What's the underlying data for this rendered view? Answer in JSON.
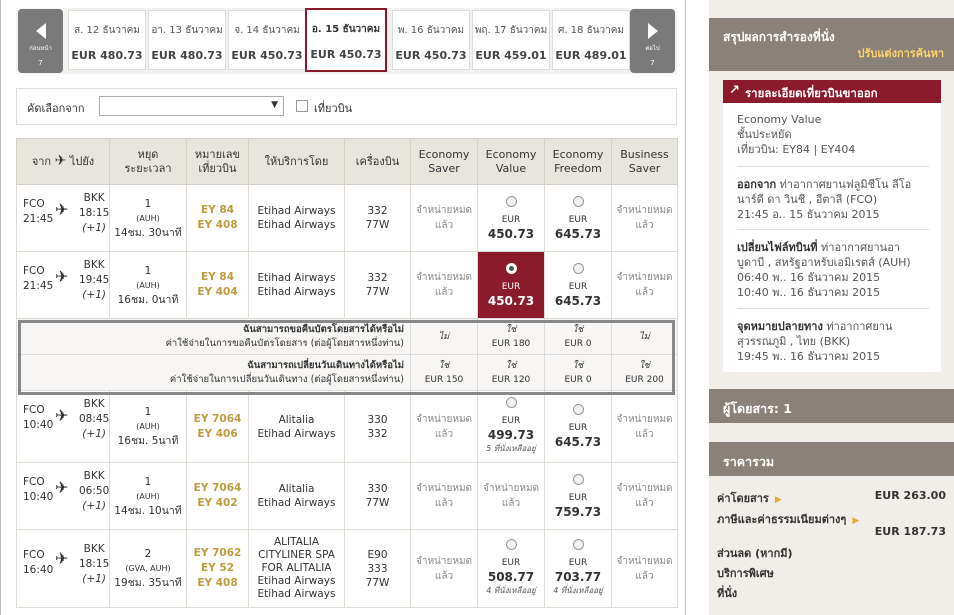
{
  "nav": {
    "prev_label": "ก่อนหน้า",
    "prev_num": "7",
    "next_label": "ต่อไป",
    "next_num": "7"
  },
  "dates": [
    {
      "label": "ส. 12 ธันวาคม",
      "price": "EUR 480.73"
    },
    {
      "label": "อา. 13 ธันวาคม",
      "price": "EUR 480.73"
    },
    {
      "label": "จ. 14 ธันวาคม",
      "price": "EUR 450.73"
    },
    {
      "label": "อ. 15 ธันวาคม",
      "price": "EUR 450.73"
    },
    {
      "label": "พ. 16 ธันวาคม",
      "price": "EUR 450.73"
    },
    {
      "label": "พฤ. 17 ธันวาคม",
      "price": "EUR 459.01"
    },
    {
      "label": "ศ. 18 ธันวาคม",
      "price": "EUR 489.01"
    }
  ],
  "filter": {
    "label": "คัดเลือกจาก",
    "checkbox_label": "เที่ยวบิน"
  },
  "headers": {
    "from": "จาก",
    "to": "ไปยัง",
    "stops": "หยุด",
    "duration": "ระยะเวลา",
    "flight1": "หมายเลข",
    "flight2": "เที่ยวบิน",
    "operator": "ให้บริการโดย",
    "aircraft": "เครื่องบิน",
    "c1a": "Economy",
    "c1b": "Saver",
    "c2a": "Economy",
    "c2b": "Value",
    "c3a": "Economy",
    "c3b": "Freedom",
    "c4a": "Business",
    "c4b": "Saver"
  },
  "na_text1": "จำหน่ายหมด",
  "na_text2": "แล้ว",
  "eur": "EUR",
  "rows": [
    {
      "dep": "FCO",
      "dep_t": "21:45",
      "arr": "BKK",
      "arr_t": "18:15",
      "plus": "(+1)",
      "stops": "1",
      "via": "(AUH)",
      "dur": "14ชม. 30นาที",
      "f1": "EY 84",
      "f2": "EY 408",
      "op1": "Etihad Airways",
      "op2": "Etihad Airways",
      "ac1": "332",
      "ac2": "77W",
      "value": "450.73",
      "freedom": "645.73"
    },
    {
      "dep": "FCO",
      "dep_t": "21:45",
      "arr": "BKK",
      "arr_t": "19:45",
      "plus": "(+1)",
      "stops": "1",
      "via": "(AUH)",
      "dur": "16ชม. 0นาที",
      "f1": "EY 84",
      "f2": "EY 404",
      "op1": "Etihad Airways",
      "op2": "Etihad Airways",
      "ac1": "332",
      "ac2": "77W",
      "value": "450.73",
      "freedom": "645.73"
    },
    {
      "dep": "FCO",
      "dep_t": "10:40",
      "arr": "BKK",
      "arr_t": "08:45",
      "plus": "(+1)",
      "stops": "1",
      "via": "(AUH)",
      "dur": "16ชม. 5นาที",
      "f1": "EY 7064",
      "f2": "EY 406",
      "op1": "Alitalia",
      "op2": "Etihad Airways",
      "ac1": "330",
      "ac2": "332",
      "value": "499.73",
      "value_seats": "5 ที่นั่งเหลืออยู่",
      "freedom": "645.73"
    },
    {
      "dep": "FCO",
      "dep_t": "10:40",
      "arr": "BKK",
      "arr_t": "06:50",
      "plus": "(+1)",
      "stops": "1",
      "via": "(AUH)",
      "dur": "14ชม. 10นาที",
      "f1": "EY 7064",
      "f2": "EY 402",
      "op1": "Alitalia",
      "op2": "Etihad Airways",
      "ac1": "330",
      "ac2": "77W",
      "freedom": "759.73"
    },
    {
      "dep": "FCO",
      "dep_t": "16:40",
      "arr": "BKK",
      "arr_t": "18:15",
      "plus": "(+1)",
      "stops": "2",
      "via": "(GVA, AUH)",
      "dur": "19ชม. 35นาที",
      "f1": "EY 7062",
      "f2": "EY 52",
      "f3": "EY 408",
      "op1": "ALITALIA",
      "op2": "CITYLINER SPA",
      "op3": "FOR ALITALIA",
      "op4": "Etihad Airways",
      "op5": "Etihad Airways",
      "ac1": "E90",
      "ac2": "333",
      "ac3": "77W",
      "value": "508.77",
      "value_seats": "4 ที่นั่งเหลืออยู่",
      "freedom": "703.77",
      "freedom_seats": "4 ที่นั่งเหลืออยู่"
    }
  ],
  "conditions": [
    {
      "t1": "ฉันสามารถขอคืนบัตรโดยสารได้หรือไม่",
      "t2": "ค่าใช้จ่ายในการขอคืนบัตรโดยสาร (ต่อผู้โดยสารหนึ่งท่าน)",
      "c1a": "ไม่",
      "c1b": "",
      "c2a": "ใช่",
      "c2b": "EUR 180",
      "c3a": "ใช่",
      "c3b": "EUR 0",
      "c4a": "ไม่",
      "c4b": ""
    },
    {
      "t1": "ฉันสามารถเปลี่ยนวันเดินทางได้หรือไม่",
      "t2": "ค่าใช้จ่ายในการเปลี่ยนวันเดินทาง (ต่อผู้โดยสารหนึ่งท่าน)",
      "c1a": "ใช่",
      "c1b": "EUR 150",
      "c2a": "ใช่",
      "c2b": "EUR 120",
      "c3a": "ใช่",
      "c3b": "EUR 0",
      "c4a": "ใช่",
      "c4b": "EUR 200"
    }
  ],
  "summary": {
    "title": "สรุปผลการสำรองที่นั่ง",
    "modify": "ปรับแต่งการค้นหา",
    "outbound_title": "รายละเอียดเที่ยวบินขาออก",
    "fare": "Economy Value",
    "cabin": "ชั้นประหยัด",
    "flights": "เที่ยวบิน: EY84 | EY404",
    "dep_label": "ออกจาก",
    "dep_text1": "ท่าอากาศยานฟลูมิชีโน ลีโอ",
    "dep_text2": "นาร์ดี ดา วินชี , อีตาลี (FCO)",
    "dep_time": "21:45 อ.. 15 ธันวาคม 2015",
    "conn_label": "เปลี่ยนไฟล์ทบินที่",
    "conn_text1": "ท่าอากาศยานอา",
    "conn_text2": "บูดาบี , สหรัฐอาหรับเอมิเรตส์ (AUH)",
    "conn_t1": "06:40 พ.. 16 ธันวาคม 2015",
    "conn_t2": "10:40 พ.. 16 ธันวาคม 2015",
    "dest_label": "จุดหมายปลายทาง",
    "dest_text1": "ท่าอากาศยาน",
    "dest_text2": "สุวรรณภูมิ , ไทย (BKK)",
    "dest_time": "19:45 พ.. 16 ธันวาคม 2015",
    "passengers": "ผู้โดยสาร: 1",
    "total_title": "ราคารวม",
    "fare_label": "ค่าโดยสาร",
    "fare_value": "EUR 263.00",
    "tax_label": "ภาษีและค่าธรรมเนียมต่างๆ",
    "tax_value": "EUR 187.73",
    "discount": "ส่วนลด (หากมี)",
    "special": "บริการพิเศษ",
    "seat": "ที่นั่ง"
  },
  "colors": {
    "brand": "#8b1a2b",
    "flight_no": "#c19a3c",
    "panel": "#8a8279"
  }
}
